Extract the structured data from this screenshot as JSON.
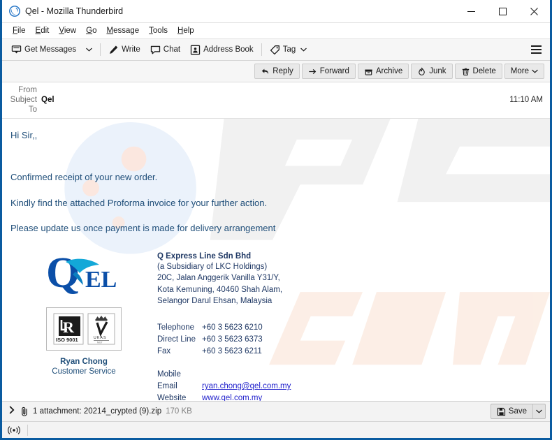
{
  "window": {
    "title": "Qel - Mozilla Thunderbird",
    "app_icon": "thunderbird-icon",
    "minimize_label": "─",
    "maximize_label": "□",
    "close_label": "✕"
  },
  "menubar": {
    "items": [
      {
        "label": "File",
        "accel": "F"
      },
      {
        "label": "Edit",
        "accel": "E"
      },
      {
        "label": "View",
        "accel": "V"
      },
      {
        "label": "Go",
        "accel": "G"
      },
      {
        "label": "Message",
        "accel": "M"
      },
      {
        "label": "Tools",
        "accel": "T"
      },
      {
        "label": "Help",
        "accel": "H"
      }
    ]
  },
  "toolbar": {
    "get_messages": "Get Messages",
    "write": "Write",
    "chat": "Chat",
    "address_book": "Address Book",
    "tag": "Tag",
    "menu_icon": "hamburger-menu-icon"
  },
  "message_actions": {
    "reply": "Reply",
    "forward": "Forward",
    "archive": "Archive",
    "junk": "Junk",
    "delete": "Delete",
    "more": "More"
  },
  "headers": {
    "from_label": "From",
    "from_value": "",
    "subject_label": "Subject",
    "subject_value": "Qel",
    "to_label": "To",
    "to_value": "",
    "time": "11:10 AM"
  },
  "body": {
    "greeting": "Hi Sir,,",
    "paragraphs": [
      "Confirmed receipt of your new order.",
      "Kindly find the attached Proforma invoice for your further action.",
      "Please update us once payment is made for delivery arrangement"
    ]
  },
  "signature": {
    "logo_text": "QEL",
    "logo_q": "Q",
    "logo_el": "EL",
    "cert_1": "ISO 9001",
    "cert_1_mark": "LR",
    "cert_2": "UKAS",
    "person_name": "Ryan Chong",
    "person_role": "Customer Service",
    "company_name": "Q Express Line Sdn Bhd",
    "company_lines": [
      "(a Subsidiary of LKC Holdings)",
      "20C, Jalan Anggerik Vanilla Y31/Y,",
      "Kota Kemuning, 40460 Shah Alam,",
      "Selangor Darul Ehsan, Malaysia"
    ],
    "contacts": [
      {
        "key": "Telephone",
        "value": "+60 3 5623 6210",
        "link": false
      },
      {
        "key": "Direct Line",
        "value": "+60 3 5623 6373",
        "link": false
      },
      {
        "key": "Fax",
        "value": "+60 3 5623 6211",
        "link": false
      }
    ],
    "contacts2": [
      {
        "key": "Mobile",
        "value": "",
        "link": false
      },
      {
        "key": "Email",
        "value": "ryan.chong@qel.com.my",
        "link": true
      },
      {
        "key": "Website",
        "value": "www.qel.com.my",
        "link": true
      }
    ]
  },
  "attachment": {
    "expand_icon": "chevron-right-icon",
    "paperclip_icon": "paperclip-icon",
    "text": "1 attachment: 20214_crypted (9).zip",
    "size": "170 KB",
    "save_label": "Save",
    "save_icon": "floppy-disk-icon"
  },
  "statusbar": {
    "icon": "broadcast-icon"
  },
  "colors": {
    "window_border": "#0a5ba0",
    "body_text": "#1f4e79",
    "signature_text": "#1f3864",
    "link": "#2222cc",
    "toolbar_bg": "#f6f6f6",
    "logo_blue": "#0d6fc4",
    "watermark_grey": "#f0f0f0",
    "watermark_peach": "#fdeee4"
  }
}
